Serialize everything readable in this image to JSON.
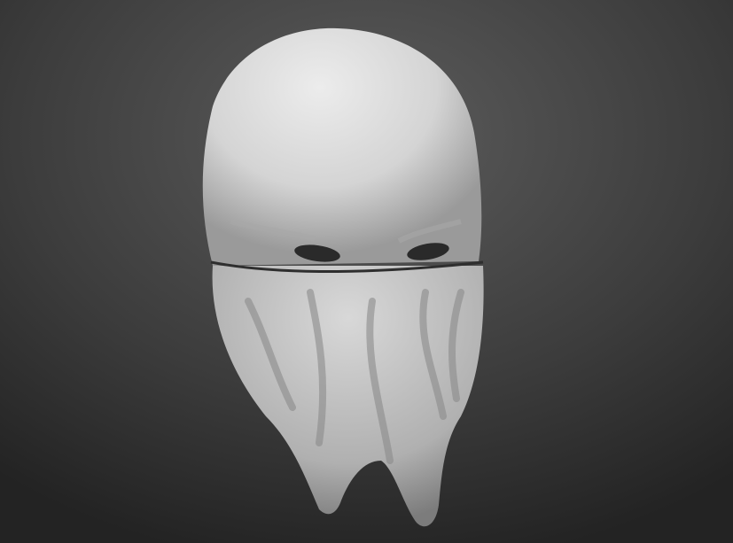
{
  "scene": {
    "subject": "sculpted-mask-model",
    "colors": {
      "background_light": "#5c5c5c",
      "background_dark": "#232323",
      "model_light": "#e6e6e6",
      "model_mid": "#bdbdbd",
      "model_shadow": "#7a7a7a",
      "seam": "#2e2e2e"
    }
  }
}
